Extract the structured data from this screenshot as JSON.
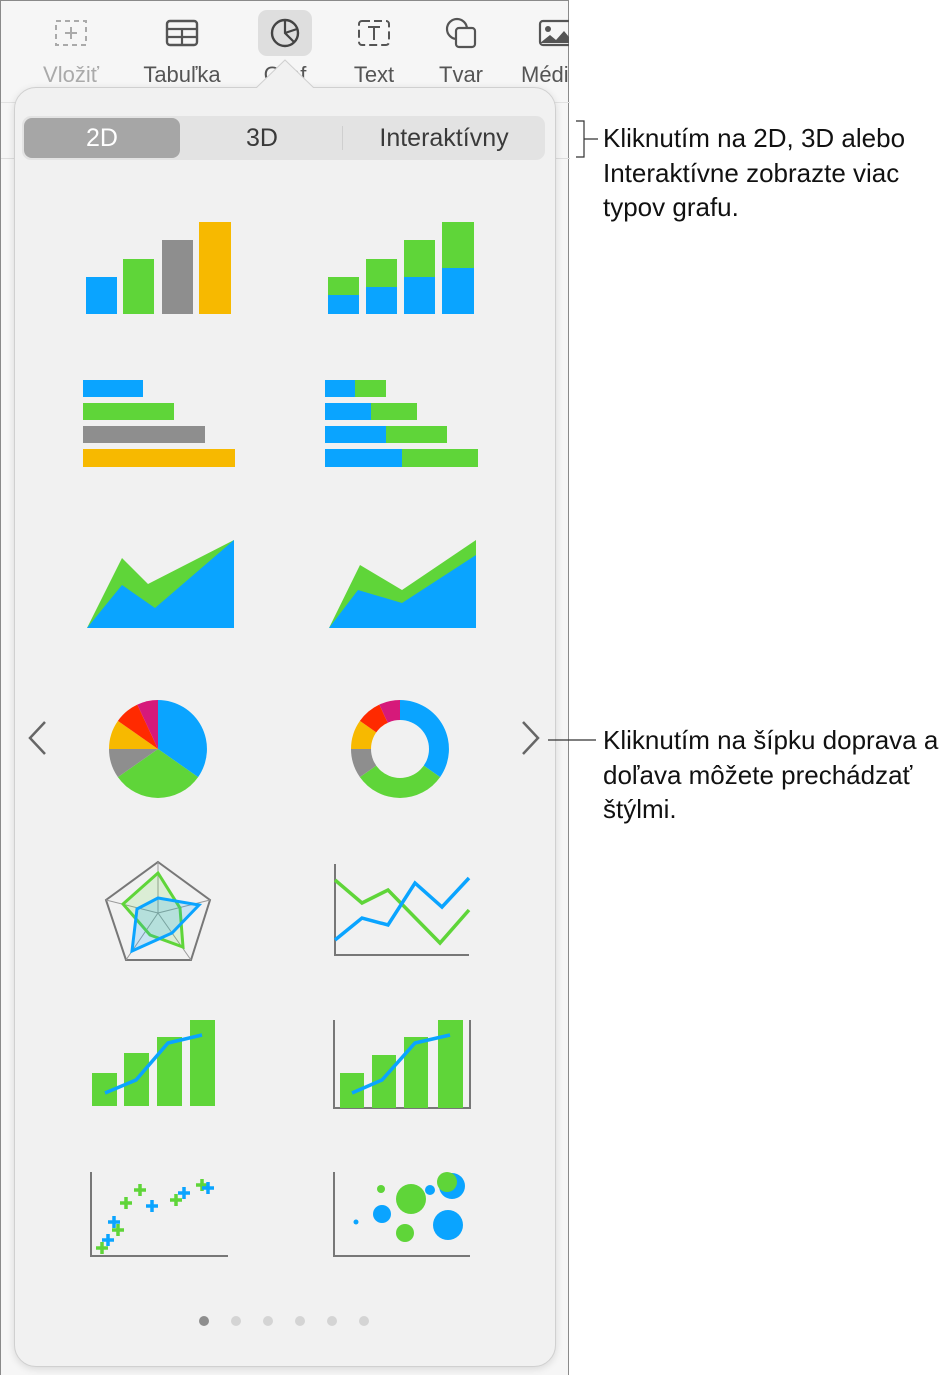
{
  "toolbar": {
    "items": [
      {
        "label": "Vložiť",
        "icon": "insert-icon"
      },
      {
        "label": "Tabuľka",
        "icon": "table-icon"
      },
      {
        "label": "Graf",
        "icon": "chart-icon",
        "selected": true
      },
      {
        "label": "Text",
        "icon": "text-box-icon"
      },
      {
        "label": "Tvar",
        "icon": "shape-icon"
      },
      {
        "label": "Médiá",
        "icon": "media-icon"
      }
    ]
  },
  "popover": {
    "segments": [
      "2D",
      "3D",
      "Interaktívny"
    ],
    "selected_segment": "2D",
    "chart_types": [
      "column",
      "stacked-column",
      "bar",
      "stacked-bar",
      "area",
      "stacked-area",
      "pie",
      "donut",
      "radar",
      "line",
      "mixed",
      "two-axis",
      "scatter",
      "bubble"
    ],
    "page_count": 6,
    "current_page": 1,
    "prev_icon": "chevron-left-icon",
    "next_icon": "chevron-right-icon"
  },
  "callouts": {
    "segments": "Kliknutím na 2D, 3D alebo Interaktívne zobrazte viac typov grafu.",
    "arrows": "Kliknutím na šípku doprava a doľava môžete prechádzať štýlmi."
  },
  "colors": {
    "blue": "#0aa4ff",
    "green": "#5fd539",
    "gray": "#8e8e8e",
    "yellow": "#f7b900",
    "red": "#ff2a00",
    "magenta": "#d6197a",
    "selected_segment": "#a6a6a6"
  }
}
